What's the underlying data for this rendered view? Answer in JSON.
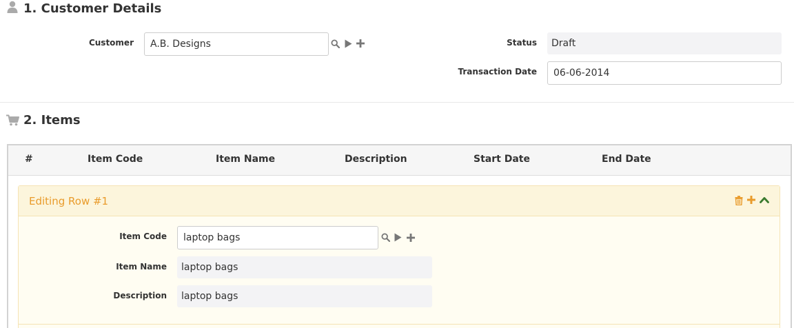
{
  "customer_details": {
    "title": "1. Customer Details",
    "customer_label": "Customer",
    "customer_value": "A.B. Designs",
    "status_label": "Status",
    "status_value": "Draft",
    "transaction_date_label": "Transaction Date",
    "transaction_date_value": "06-06-2014"
  },
  "items": {
    "title": "2. Items",
    "columns": [
      "#",
      "Item Code",
      "Item Name",
      "Description",
      "Start Date",
      "End Date"
    ],
    "editing_row": {
      "title": "Editing Row #1",
      "item_code_label": "Item Code",
      "item_code_value": "laptop bags",
      "item_name_label": "Item Name",
      "item_name_value": "laptop bags",
      "description_label": "Description",
      "description_value": "laptop bags"
    }
  },
  "icons": {
    "section_customer": "user-icon",
    "section_items": "cart-icon",
    "search": "search-icon",
    "open": "play-icon",
    "add": "plus-icon",
    "delete_row": "trash-icon",
    "add_row": "plus-icon",
    "collapse_row": "chevron-up-icon"
  },
  "colors": {
    "edit_title": "#e99b2b",
    "edit_header_bg": "#fcf5dc",
    "edit_body_bg": "#fffdf2",
    "collapse_icon": "#3a7a2e",
    "action_icon": "#777777"
  }
}
